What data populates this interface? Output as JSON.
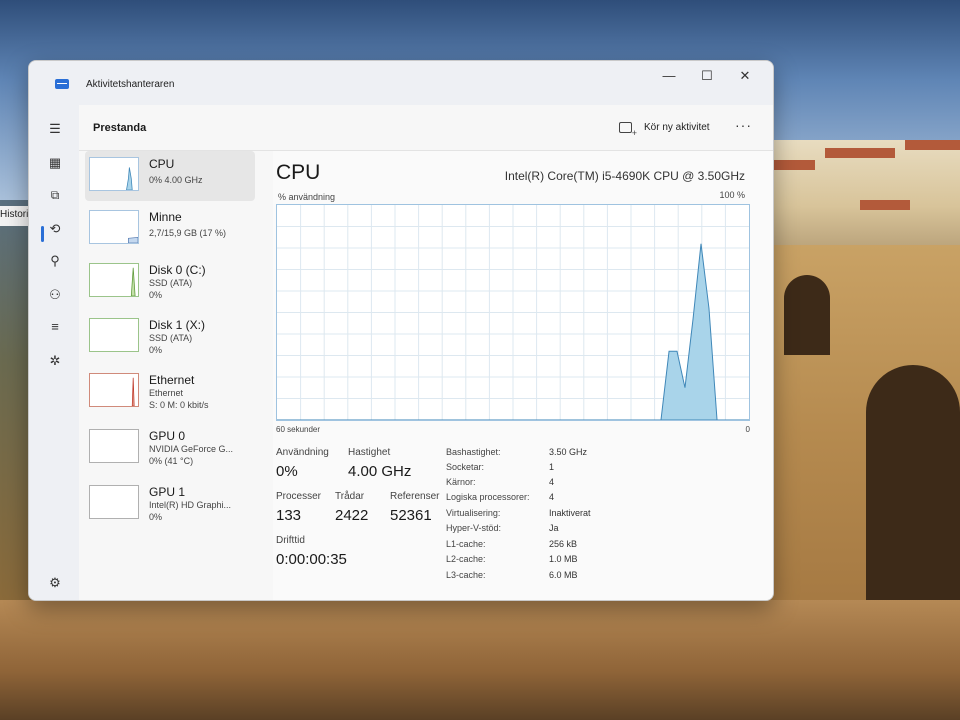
{
  "desktop": {
    "tooltip": "Historik"
  },
  "window": {
    "title": "Aktivitetshanteraren",
    "controls": {
      "minimize": "—",
      "maximize": "☐",
      "close": "✕"
    }
  },
  "rail": {
    "icons": [
      "hamburger-icon",
      "processes-icon",
      "performance-icon",
      "app-history-icon",
      "startup-icon",
      "users-icon",
      "details-icon",
      "services-icon",
      "settings-icon"
    ]
  },
  "header": {
    "title": "Prestanda",
    "run_task_label": "Kör ny aktivitet",
    "more_label": "···"
  },
  "sidebar": {
    "items": [
      {
        "name": "CPU",
        "sub1": "0% 4.00 GHz",
        "sub2": ""
      },
      {
        "name": "Minne",
        "sub1": "2,7/15,9 GB (17 %)",
        "sub2": ""
      },
      {
        "name": "Disk 0 (C:)",
        "sub1": "SSD (ATA)",
        "sub2": "0%"
      },
      {
        "name": "Disk 1 (X:)",
        "sub1": "SSD (ATA)",
        "sub2": "0%"
      },
      {
        "name": "Ethernet",
        "sub1": "Ethernet",
        "sub2": "S: 0 M: 0 kbit/s"
      },
      {
        "name": "GPU 0",
        "sub1": "NVIDIA GeForce G...",
        "sub2": "0% (41 °C)"
      },
      {
        "name": "GPU 1",
        "sub1": "Intel(R) HD Graphi...",
        "sub2": "0%"
      }
    ]
  },
  "cpu": {
    "title": "CPU",
    "model": "Intel(R) Core(TM) i5-4690K CPU @ 3.50GHz",
    "usage_label": "% användning",
    "max_label": "100 %",
    "axis_left": "60 sekunder",
    "axis_right": "0",
    "stats": {
      "usage_label": "Användning",
      "usage_value": "0%",
      "speed_label": "Hastighet",
      "speed_value": "4.00 GHz",
      "processes_label": "Processer",
      "processes_value": "133",
      "threads_label": "Trådar",
      "threads_value": "2422",
      "handles_label": "Referenser",
      "handles_value": "52361",
      "uptime_label": "Drifttid",
      "uptime_value": "0:00:00:35"
    },
    "specs": [
      {
        "label": "Bashastighet:",
        "value": "3.50 GHz"
      },
      {
        "label": "Socketar:",
        "value": "1"
      },
      {
        "label": "Kärnor:",
        "value": "4"
      },
      {
        "label": "Logiska processorer:",
        "value": "4"
      },
      {
        "label": "Virtualisering:",
        "value": "Inaktiverat"
      },
      {
        "label": "Hyper-V-stöd:",
        "value": "Ja"
      },
      {
        "label": "L1-cache:",
        "value": "256 kB"
      },
      {
        "label": "L2-cache:",
        "value": "1.0 MB"
      },
      {
        "label": "L3-cache:",
        "value": "6.0 MB"
      }
    ],
    "graph_series": [
      0,
      0,
      0,
      0,
      0,
      0,
      0,
      0,
      0,
      0,
      0,
      0,
      0,
      0,
      0,
      0,
      0,
      0,
      0,
      0,
      0,
      0,
      0,
      0,
      0,
      0,
      0,
      0,
      0,
      0,
      0,
      0,
      0,
      0,
      0,
      0,
      0,
      0,
      0,
      0,
      0,
      0,
      0,
      0,
      0,
      0,
      0,
      0,
      0,
      32,
      32,
      15,
      47,
      82,
      52,
      0,
      0,
      0,
      0,
      0
    ],
    "colors": {
      "accent": "#2a6fd6",
      "graph_fill": "#a9d4ea",
      "graph_line": "#3f87b8",
      "grid": "#dde8f0"
    }
  }
}
